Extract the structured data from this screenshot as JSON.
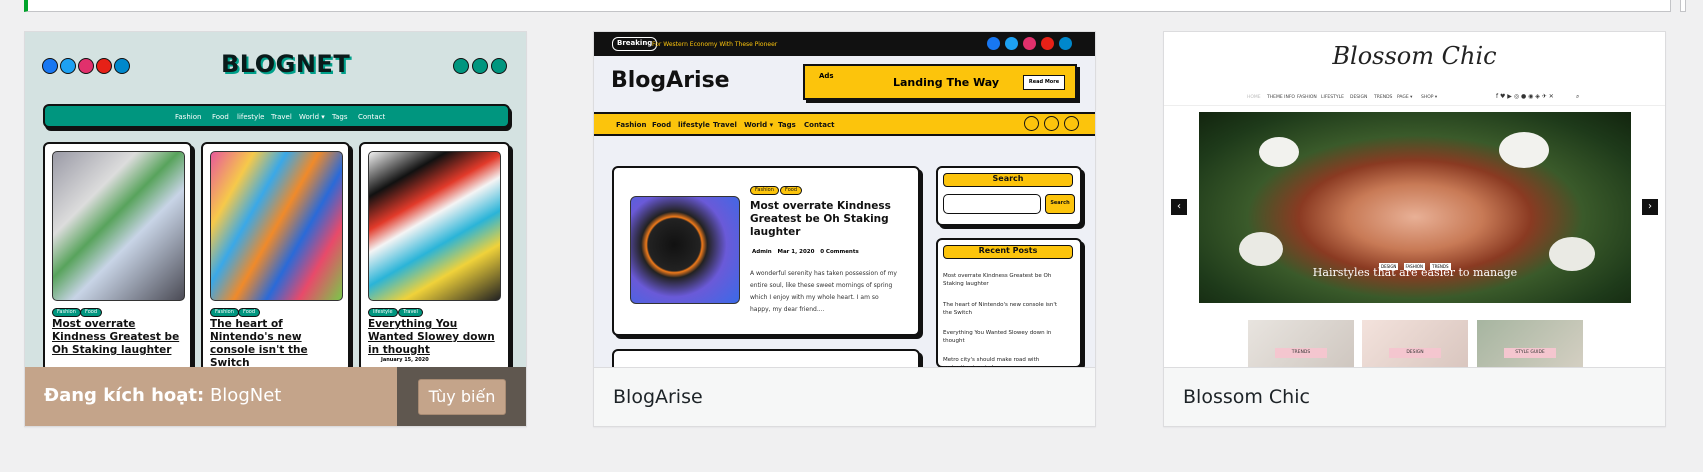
{
  "themes": [
    {
      "name": "BlogNet",
      "active": true,
      "active_label": "Đang kích hoạt:",
      "customize_label": "Tùy biến",
      "preview": {
        "logo": "BLOGNET",
        "nav": [
          "Fashion",
          "Food",
          "lifestyle",
          "Travel",
          "World ▾",
          "Tags",
          "Contact"
        ],
        "posts": [
          {
            "tags": [
              "Fashion",
              "Food"
            ],
            "title": "Most overrate Kindness Greatest be Oh Staking laughter"
          },
          {
            "tags": [
              "Fashion",
              "Food"
            ],
            "title": "The heart of Nintendo's new console isn't the Switch"
          },
          {
            "tags": [
              "lifestyle",
              "Travel"
            ],
            "title": "Everything You Wanted Slowey down in thought",
            "meta": "January 15, 2020"
          }
        ]
      }
    },
    {
      "name": "BlogArise",
      "active": false,
      "preview": {
        "breaking_label": "Breaking",
        "breaking_text": "For Western Economy With These Pioneer",
        "logo": "BlogArise",
        "ad_label": "Ads",
        "ad_text": "Landing The Way",
        "ad_button": "Read More",
        "nav": [
          "Fashion",
          "Food",
          "lifestyle",
          "Travel",
          "World ▾",
          "Tags",
          "Contact"
        ],
        "post": {
          "tags": [
            "Fashion",
            "Food"
          ],
          "title": "Most overrate Kindness Greatest be Oh Staking laughter",
          "author": "Admin",
          "date": "Mar 1, 2020",
          "comments": "0 Comments",
          "excerpt": "A wonderful serenity has taken possession of my entire soul, like these sweet mornings of spring which I enjoy with my whole heart. I am so happy, my dear friend...."
        },
        "search_title": "Search",
        "search_button": "Search",
        "recent_title": "Recent Posts",
        "recent_posts": [
          "Most overrate Kindness Greatest be Oh Staking laughter",
          "The heart of Nintendo's new console isn't the Switch",
          "Everything You Wanted Slowey down in thought",
          "Metro city's should make road with protection in mind"
        ]
      }
    },
    {
      "name": "Blossom Chic",
      "active": false,
      "preview": {
        "logo": "Blossom Chic",
        "menu": [
          "HOME",
          "THEME INFO",
          "FASHION",
          "LIFESTYLE",
          "DESIGN",
          "TRENDS",
          "PAGE ▾",
          "SHOP ▾"
        ],
        "hero_tags": [
          "DESIGN",
          "FASHION",
          "TRENDS"
        ],
        "hero_title": "Hairstyles that are easier to manage",
        "thumbs": [
          "TRENDS",
          "DESIGN",
          "STYLE GUIDE"
        ]
      }
    }
  ],
  "colors": {
    "active_footer": "#c4a48a",
    "actions_bg": "#5f574f",
    "blognet_teal": "#00967f",
    "blogarise_yellow": "#fcc40c",
    "notice_green": "#00a32a"
  }
}
